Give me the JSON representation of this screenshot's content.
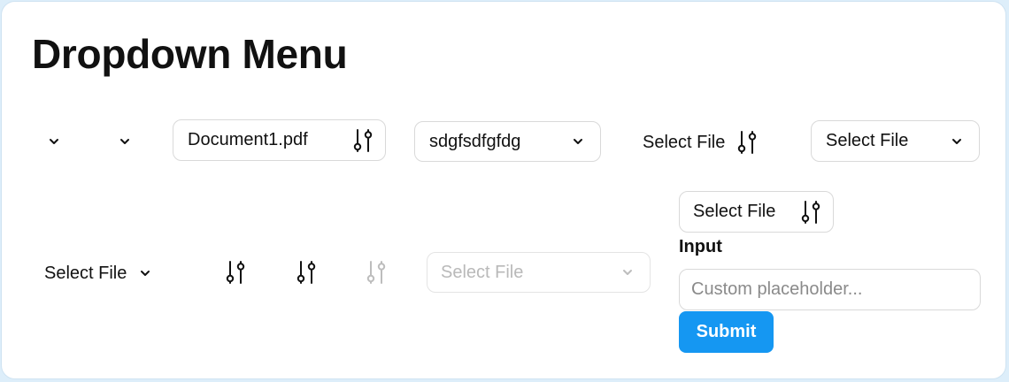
{
  "page": {
    "title": "Dropdown Menu"
  },
  "row1": {
    "document_select": {
      "label": "Document1.pdf"
    },
    "text_select": {
      "label": "sdgfsdfgfdg"
    },
    "plain_file_select": {
      "label": "Select File"
    },
    "file_select": {
      "label": "Select File"
    }
  },
  "row2": {
    "plain_select": {
      "label": "Select File"
    },
    "disabled_select": {
      "label": "Select File"
    }
  },
  "side": {
    "file_select": {
      "label": "Select File"
    },
    "input_label": "Input",
    "input_placeholder": "Custom placeholder...",
    "input_value": "",
    "submit_label": "Submit"
  },
  "colors": {
    "accent": "#1597f2",
    "disabled": "#b9b9b9",
    "border": "#d9d9d9"
  },
  "icons": {
    "dropdown": "chevron-down-icon",
    "filter": "sliders-icon"
  }
}
